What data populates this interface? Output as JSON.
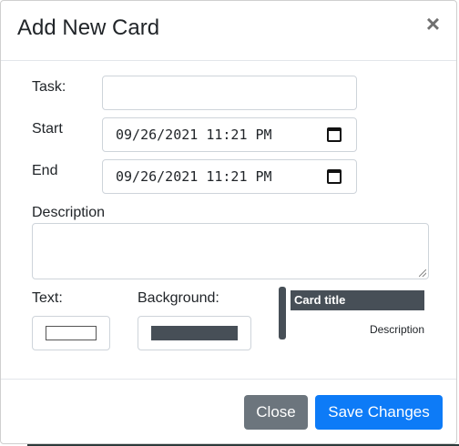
{
  "modal": {
    "title": "Add New Card",
    "close_symbol": "×"
  },
  "form": {
    "task_label": "Task:",
    "task_value": "",
    "start_label": "Start",
    "start_value": "09/26/2021 11:21 PM",
    "end_label": "End",
    "end_value": "09/26/2021 11:21 PM",
    "description_label": "Description",
    "description_value": "",
    "text_label": "Text:",
    "background_label": "Background:",
    "text_color": "#ffffff",
    "background_color": "#474f57"
  },
  "preview": {
    "card_title": "Card title",
    "card_description": "Description"
  },
  "footer": {
    "close_label": "Close",
    "save_label": "Save Changes"
  },
  "colors": {
    "primary": "#0d7bf7",
    "secondary": "#6c757d"
  },
  "icons": [
    "close-icon",
    "calendar-icon",
    "resize-handle-icon"
  ]
}
